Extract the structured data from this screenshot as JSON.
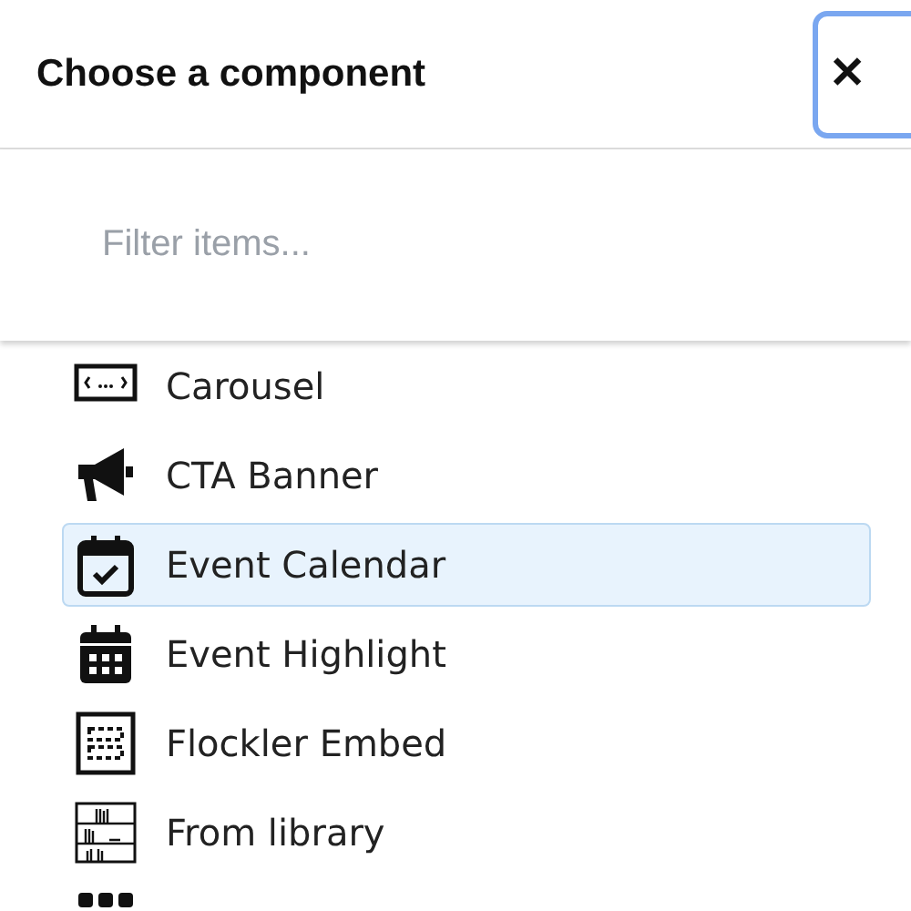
{
  "dialog": {
    "title": "Choose a component",
    "close_label": "✕"
  },
  "filter": {
    "placeholder": "Filter items..."
  },
  "items": [
    {
      "label": "Carousel",
      "selected": false
    },
    {
      "label": "CTA Banner",
      "selected": false
    },
    {
      "label": "Event Calendar",
      "selected": true
    },
    {
      "label": "Event Highlight",
      "selected": false
    },
    {
      "label": "Flockler Embed",
      "selected": false
    },
    {
      "label": "From library",
      "selected": false
    }
  ]
}
